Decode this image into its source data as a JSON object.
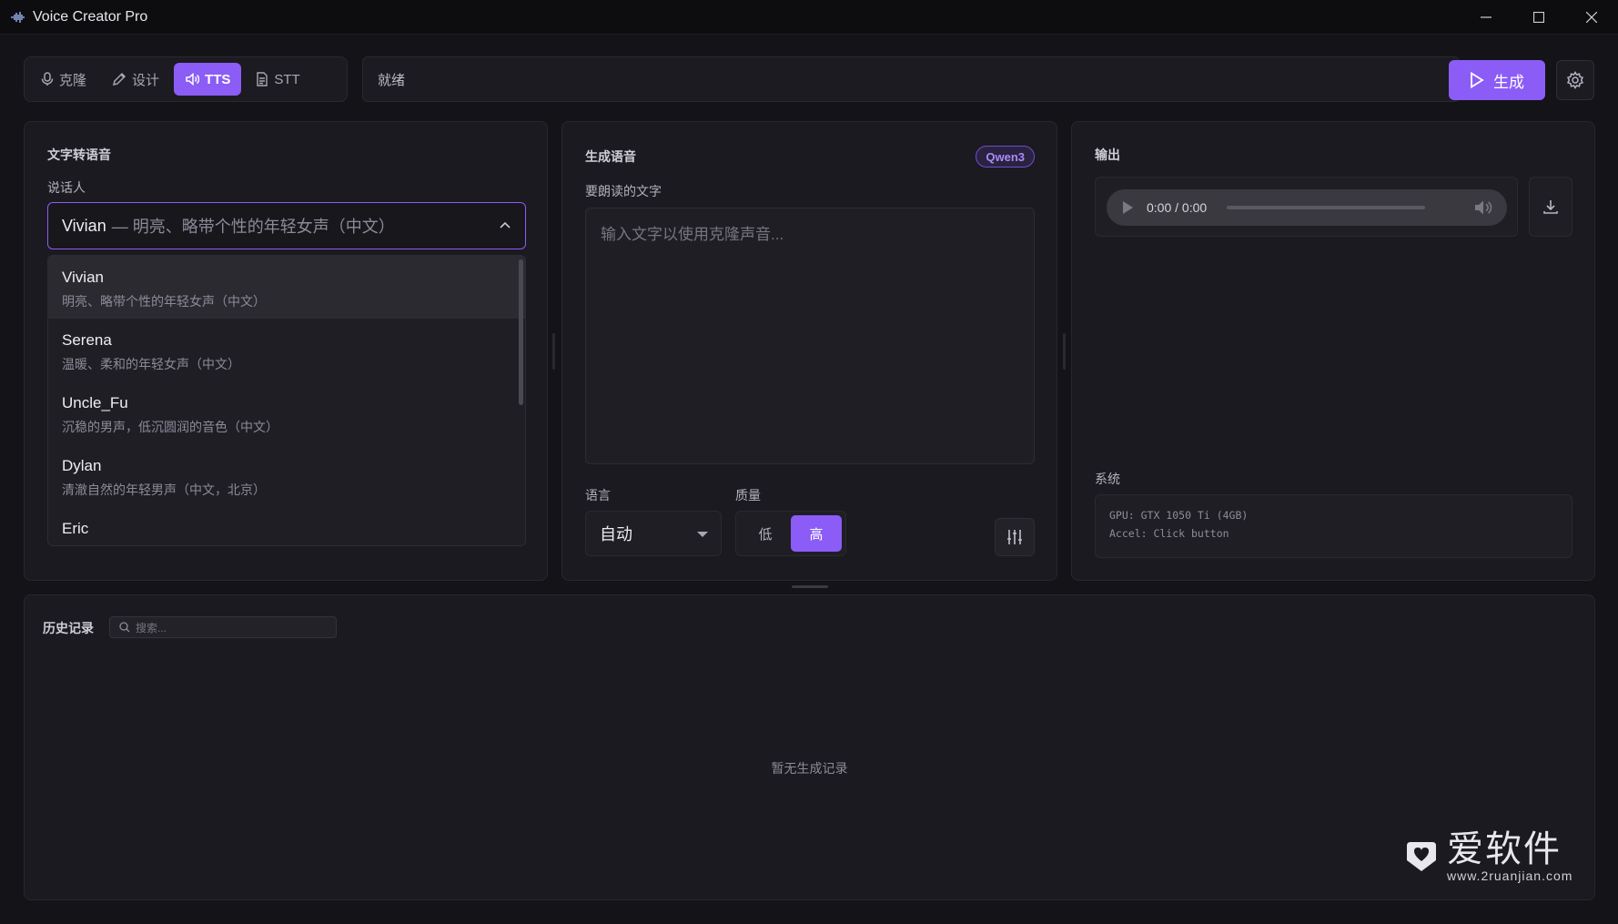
{
  "window": {
    "title": "Voice Creator Pro"
  },
  "tabs": [
    {
      "label": "克隆",
      "icon": "mic-icon",
      "active": false
    },
    {
      "label": "设计",
      "icon": "pencil-icon",
      "active": false
    },
    {
      "label": "TTS",
      "icon": "speaker-icon",
      "active": true
    },
    {
      "label": "STT",
      "icon": "document-icon",
      "active": false
    }
  ],
  "status": "就绪",
  "generate_label": "生成",
  "tts_panel": {
    "title": "文字转语音",
    "speaker_label": "说话人",
    "selected": {
      "name": "Vivian",
      "desc": "— 明亮、略带个性的年轻女声（中文）"
    },
    "options": [
      {
        "name": "Vivian",
        "desc": "明亮、略带个性的年轻女声（中文）"
      },
      {
        "name": "Serena",
        "desc": "温暖、柔和的年轻女声（中文）"
      },
      {
        "name": "Uncle_Fu",
        "desc": "沉稳的男声，低沉圆润的音色（中文）"
      },
      {
        "name": "Dylan",
        "desc": "清澈自然的年轻男声（中文，北京）"
      },
      {
        "name": "Eric",
        "desc": ""
      }
    ]
  },
  "generate_panel": {
    "title": "生成语音",
    "badge": "Qwen3",
    "text_label": "要朗读的文字",
    "text_placeholder": "输入文字以使用克隆声音...",
    "language_label": "语言",
    "language_value": "自动",
    "quality_label": "质量",
    "quality_low": "低",
    "quality_high": "高",
    "quality_selected": "高"
  },
  "output_panel": {
    "title": "输出",
    "player_time": "0:00 / 0:00",
    "system_label": "系统",
    "system_lines": [
      "GPU: GTX 1050 Ti (4GB)",
      "Accel: Click button"
    ]
  },
  "history": {
    "title": "历史记录",
    "search_placeholder": "搜索...",
    "empty_text": "暂无生成记录"
  },
  "watermark": {
    "cn": "爱软件",
    "url": "www.2ruanjian.com"
  },
  "colors": {
    "accent": "#8b5cf6",
    "background": "#141318",
    "panel": "#1b1a20"
  }
}
